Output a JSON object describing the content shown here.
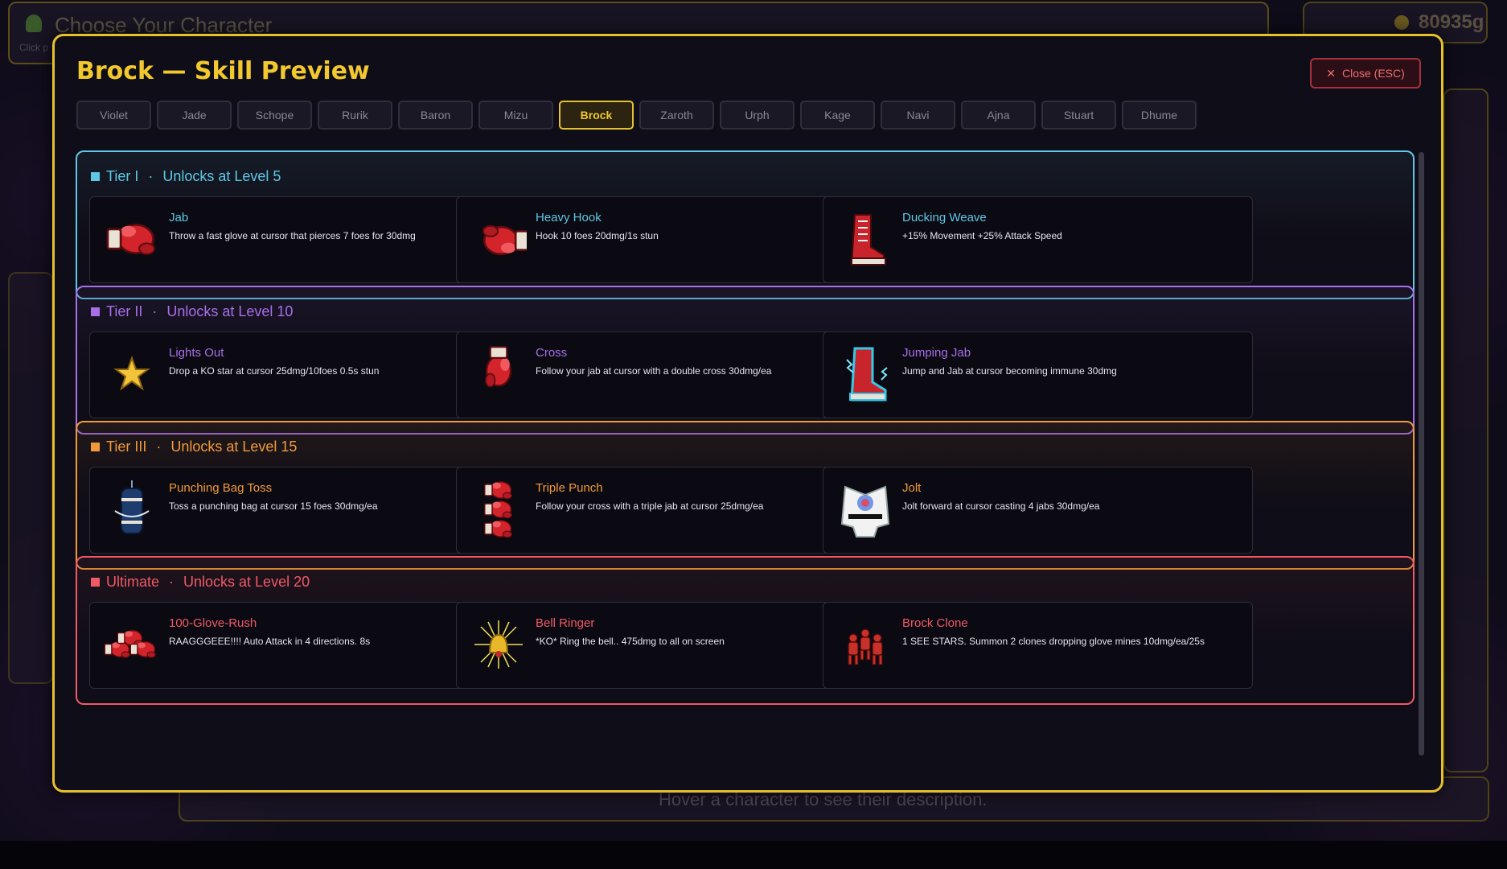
{
  "background": {
    "header_title": "Choose Your Character",
    "header_subtitle": "Click p",
    "gold": "80935g",
    "description_hint": "Hover a character to see their description."
  },
  "modal": {
    "title": "Brock — Skill Preview",
    "close_label": "Close (ESC)",
    "tabs": [
      "Violet",
      "Jade",
      "Schope",
      "Rurik",
      "Baron",
      "Mizu",
      "Brock",
      "Zaroth",
      "Urph",
      "Kage",
      "Navi",
      "Ajna",
      "Stuart",
      "Dhume"
    ],
    "active_tab": "Brock",
    "tiers": [
      {
        "name": "Tier I",
        "unlock": "Unlocks at Level 5",
        "color": "#5fc8e6",
        "skills": [
          {
            "name": "Jab",
            "desc": "Throw a fast glove at cursor that pierces 7 foes for 30dmg",
            "icon": "boxing-glove-icon"
          },
          {
            "name": "Heavy Hook",
            "desc": "Hook 10 foes 20dmg/1s stun",
            "icon": "boxing-glove-side-icon"
          },
          {
            "name": "Ducking Weave",
            "desc": "+15% Movement +25% Attack Speed",
            "icon": "boot-icon"
          }
        ]
      },
      {
        "name": "Tier II",
        "unlock": "Unlocks at Level 10",
        "color": "#a770e8",
        "skills": [
          {
            "name": "Lights Out",
            "desc": "Drop a KO star at cursor 25dmg/10foes 0.5s stun",
            "icon": "ko-star-icon"
          },
          {
            "name": "Cross",
            "desc": "Follow your jab at cursor with a double cross 30dmg/ea",
            "icon": "upright-glove-icon"
          },
          {
            "name": "Jumping Jab",
            "desc": "Jump and Jab at cursor becoming immune 30dmg",
            "icon": "electric-boot-icon"
          }
        ]
      },
      {
        "name": "Tier III",
        "unlock": "Unlocks at Level 15",
        "color": "#f29a3a",
        "skills": [
          {
            "name": "Punching Bag Toss",
            "desc": "Toss a punching bag at cursor 15 foes 30dmg/ea",
            "icon": "punching-bag-icon"
          },
          {
            "name": "Triple Punch",
            "desc": "Follow your cross with a triple jab at cursor 25dmg/ea",
            "icon": "triple-glove-icon"
          },
          {
            "name": "Jolt",
            "desc": "Jolt forward at cursor casting 4 jabs 30dmg/ea",
            "icon": "karate-gi-icon"
          }
        ]
      },
      {
        "name": "Ultimate",
        "unlock": "Unlocks at Level 20",
        "color": "#ef5a66",
        "skills": [
          {
            "name": "100-Glove-Rush",
            "desc": "RAAGGGEEE!!!! Auto Attack in 4 directions. 8s",
            "icon": "glove-cluster-icon"
          },
          {
            "name": "Bell Ringer",
            "desc": "*KO* Ring the bell.. 475dmg to all on screen",
            "icon": "bell-burst-icon"
          },
          {
            "name": "Brock Clone",
            "desc": "1 SEE STARS. Summon 2 clones dropping glove mines 10dmg/ea/25s",
            "icon": "clone-fighters-icon"
          }
        ]
      }
    ]
  }
}
